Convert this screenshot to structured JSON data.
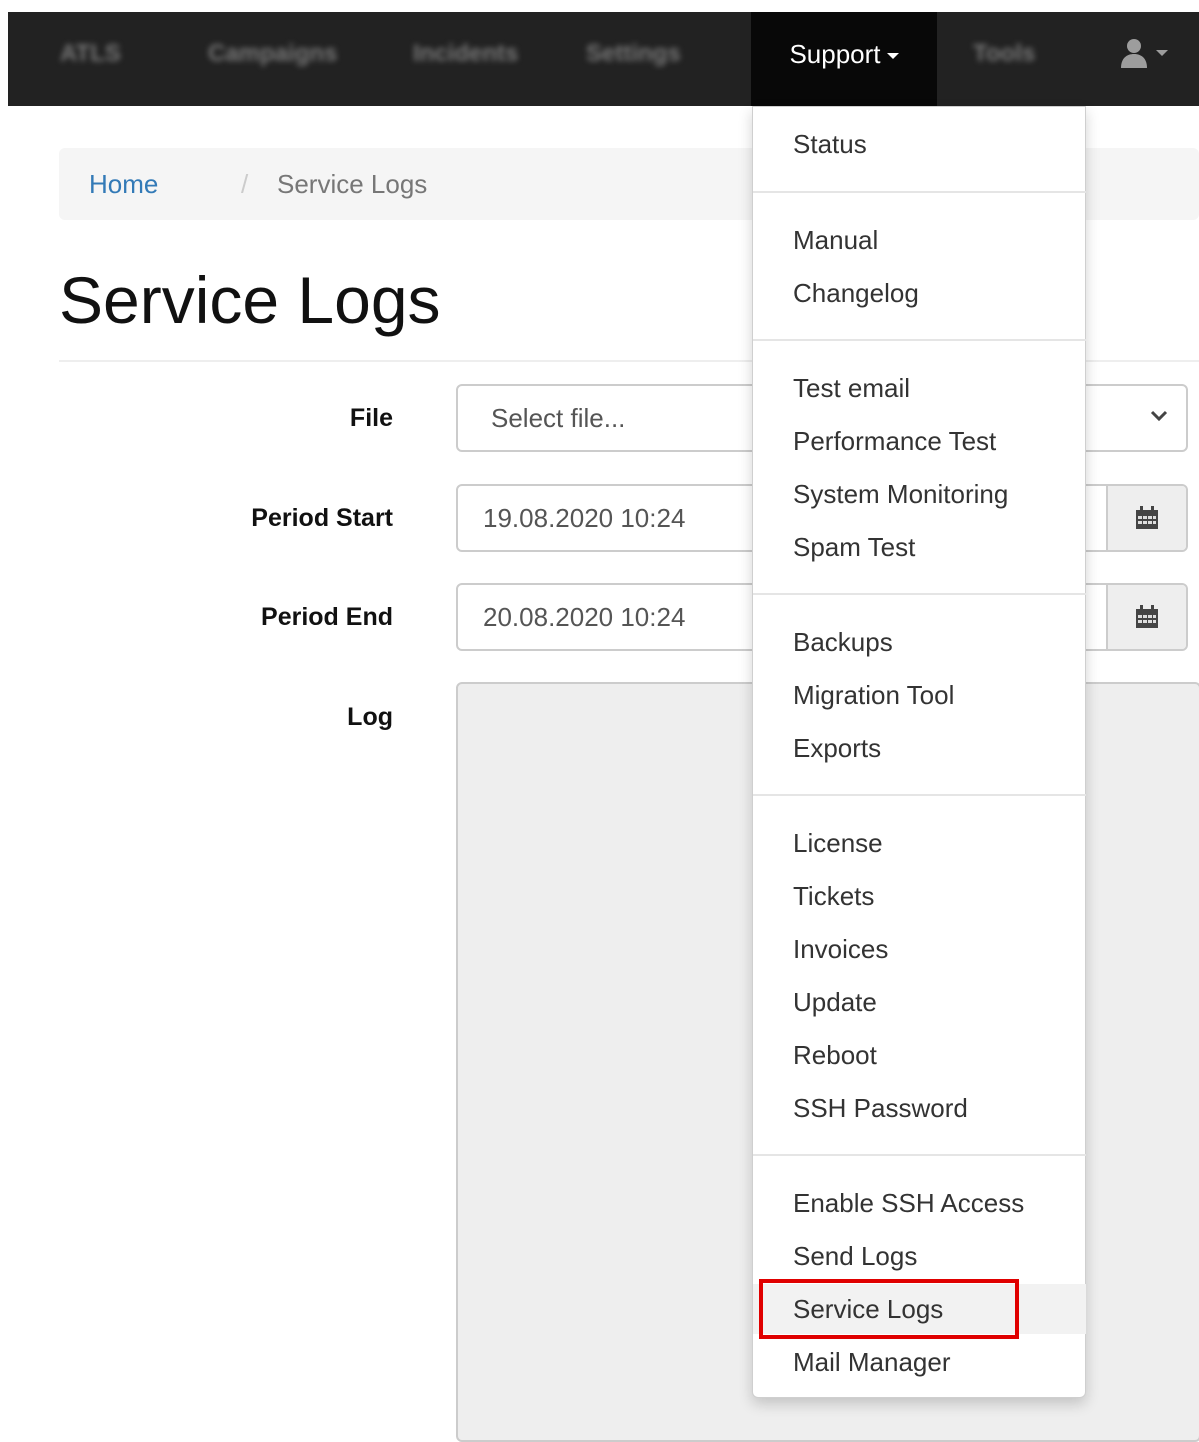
{
  "navbar": {
    "brand": "ATLS",
    "items": [
      "Campaigns",
      "Incidents",
      "Settings",
      "Tools"
    ],
    "active_label": "Support"
  },
  "breadcrumb": {
    "home": "Home",
    "separator": "/",
    "current": "Service Logs"
  },
  "page": {
    "title": "Service Logs"
  },
  "form": {
    "file_label": "File",
    "file_placeholder": "Select file...",
    "period_start_label": "Period Start",
    "period_start_value": "19.08.2020 10:24",
    "period_end_label": "Period End",
    "period_end_value": "20.08.2020 10:24",
    "log_label": "Log"
  },
  "dropdown": {
    "status": "Status",
    "manual": "Manual",
    "changelog": "Changelog",
    "test_email": "Test email",
    "performance_test": "Performance Test",
    "system_monitoring": "System Monitoring",
    "spam_test": "Spam Test",
    "backups": "Backups",
    "migration_tool": "Migration Tool",
    "exports": "Exports",
    "license": "License",
    "tickets": "Tickets",
    "invoices": "Invoices",
    "update": "Update",
    "reboot": "Reboot",
    "ssh_password": "SSH Password",
    "enable_ssh_access": "Enable SSH Access",
    "send_logs": "Send Logs",
    "service_logs": "Service Logs",
    "mail_manager": "Mail Manager"
  },
  "colors": {
    "navbar": "#222222",
    "link": "#337ab7",
    "highlight_box": "#e00000"
  },
  "icons": {
    "user": "user-icon",
    "calendar": "calendar-icon",
    "select": "chevron-down-icon"
  }
}
